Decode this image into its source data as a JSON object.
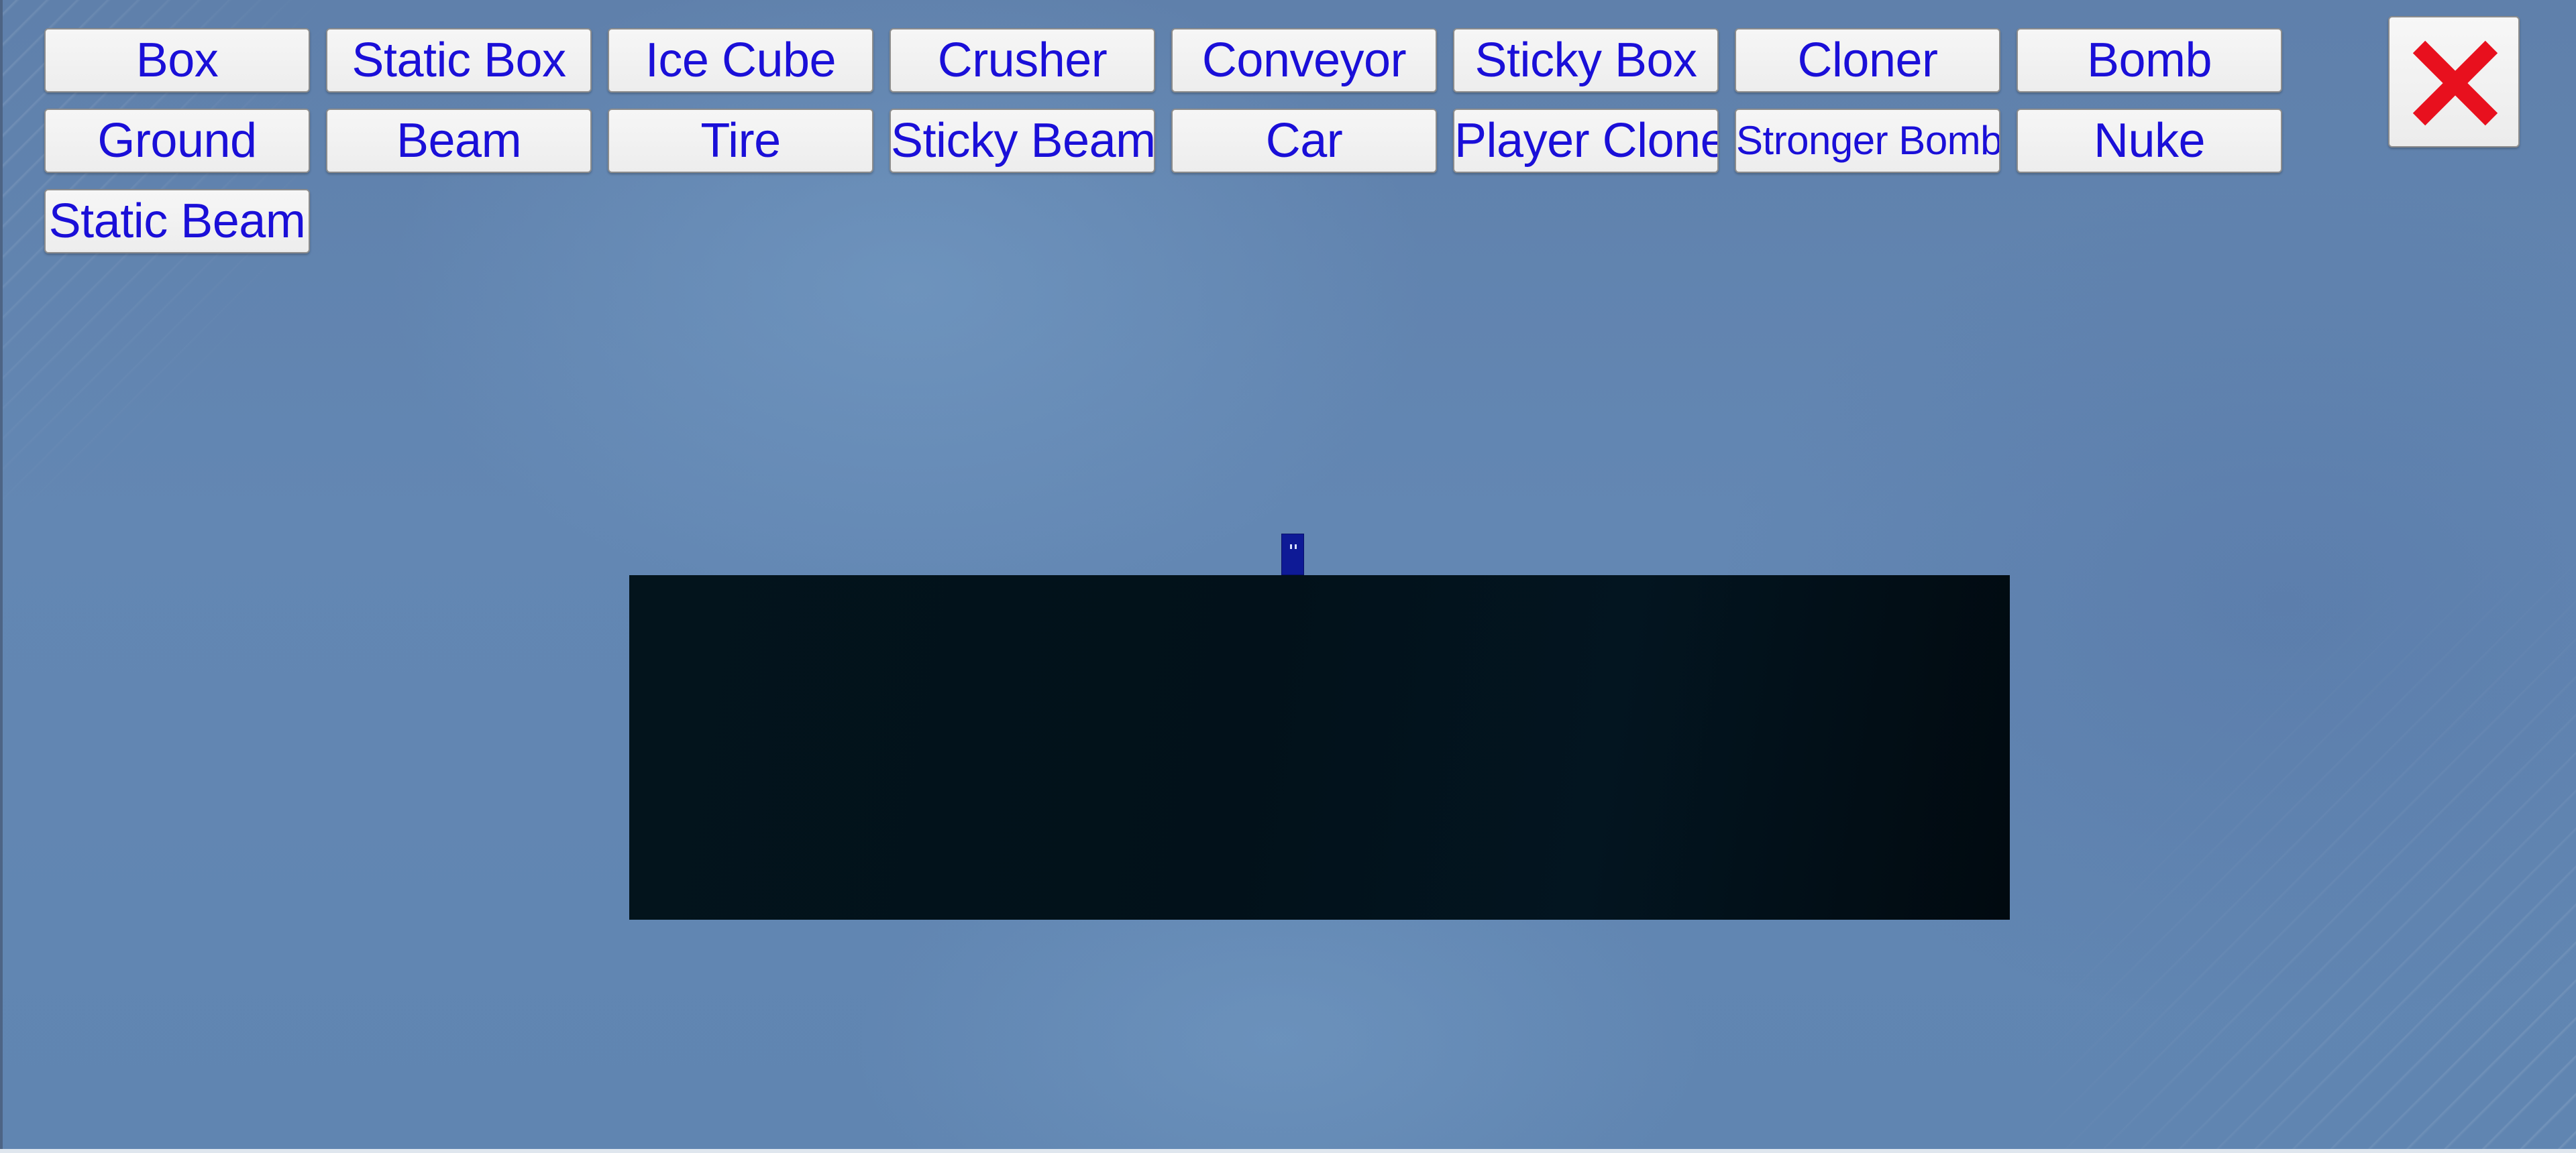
{
  "toolbar": {
    "buttons": [
      "Box",
      "Static Box",
      "Ice Cube",
      "Crusher",
      "Conveyor",
      "Sticky Box",
      "Cloner",
      "Bomb",
      "Ground",
      "Beam",
      "Tire",
      "Sticky Beam",
      "Car",
      "Player Clone",
      "Stronger Bomb",
      "Nuke",
      "Static Beam"
    ]
  },
  "close_button": {
    "icon": "close-icon",
    "color": "#e8101e"
  },
  "colors": {
    "button_text": "#1a0fd8",
    "background": "#6183ad",
    "ground": "#02111a",
    "player": "#0e1a96"
  }
}
